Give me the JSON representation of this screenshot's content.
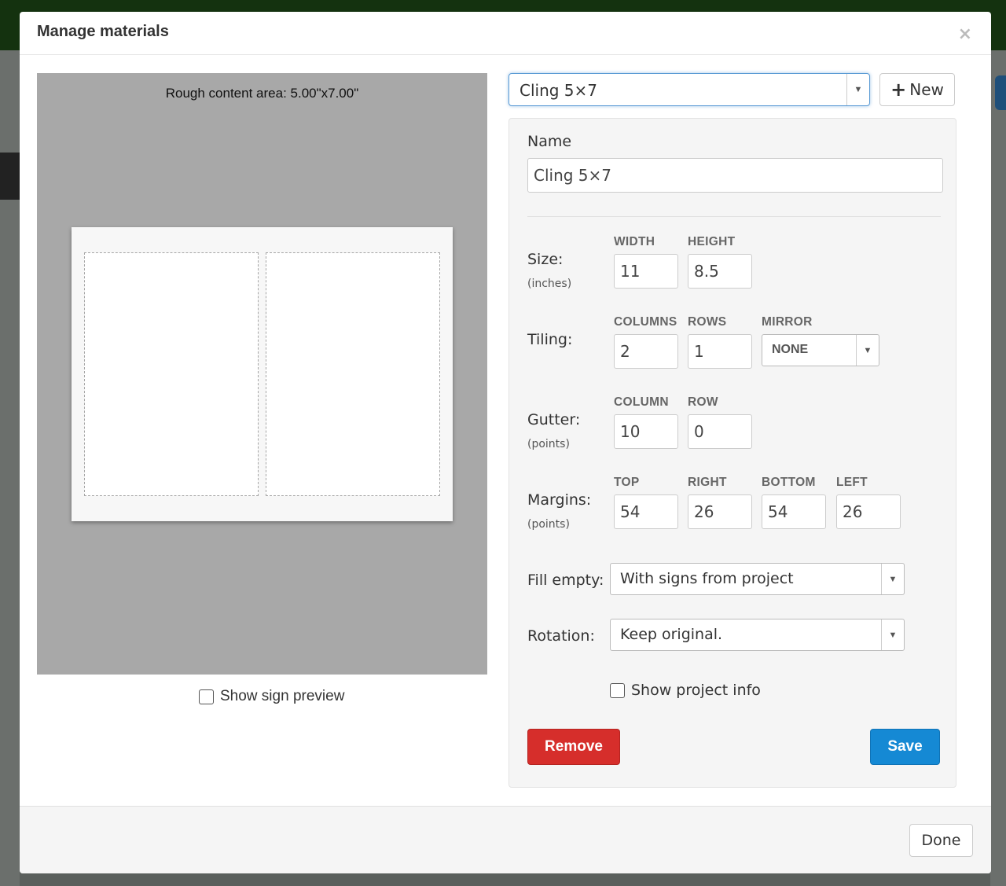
{
  "dialog": {
    "title": "Manage materials",
    "close_icon": "close-icon",
    "close_glyph": "×"
  },
  "preview": {
    "caption": "Rough content area: 5.00\"x7.00\"",
    "show_preview_label": "Show sign preview",
    "show_preview_checked": false
  },
  "material": {
    "selected": "Cling 5×7",
    "new_label": "New",
    "new_icon": "plus-icon",
    "new_glyph": "+"
  },
  "form": {
    "name_label": "Name",
    "name_value": "Cling 5×7",
    "size": {
      "label": "Size:",
      "unit": "(inches)",
      "width_header": "WIDTH",
      "height_header": "HEIGHT",
      "width": "11",
      "height": "8.5"
    },
    "tiling": {
      "label": "Tiling:",
      "columns_header": "COLUMNS",
      "rows_header": "ROWS",
      "mirror_header": "MIRROR",
      "columns": "2",
      "rows": "1",
      "mirror": "NONE"
    },
    "gutter": {
      "label": "Gutter:",
      "unit": "(points)",
      "column_header": "COLUMN",
      "row_header": "ROW",
      "column": "10",
      "row": "0"
    },
    "margins": {
      "label": "Margins:",
      "unit": "(points)",
      "top_header": "TOP",
      "right_header": "RIGHT",
      "bottom_header": "BOTTOM",
      "left_header": "LEFT",
      "top": "54",
      "right": "26",
      "bottom": "54",
      "left": "26"
    },
    "fill_empty": {
      "label": "Fill empty:",
      "value": "With signs from project"
    },
    "rotation": {
      "label": "Rotation:",
      "value": "Keep original."
    },
    "show_project_info": {
      "label": "Show project info",
      "checked": false
    },
    "remove_label": "Remove",
    "save_label": "Save"
  },
  "footer": {
    "done_label": "Done"
  },
  "colors": {
    "remove": "#d62e2b",
    "save": "#1589d4",
    "preview_bg": "#a8a8a8"
  },
  "dropdown_arrow_glyph": "▼"
}
